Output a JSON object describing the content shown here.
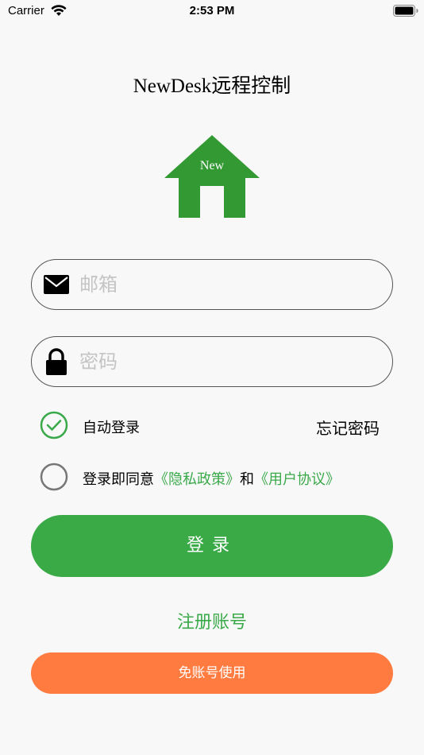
{
  "status_bar": {
    "carrier": "Carrier",
    "time": "2:53 PM",
    "wifi_icon": "wifi-icon",
    "battery_icon": "battery-full-icon"
  },
  "app": {
    "title": "NewDesk远程控制",
    "logo_text": "New",
    "logo_icon": "house-icon",
    "logo_color": "#339933"
  },
  "form": {
    "email": {
      "placeholder": "邮箱",
      "value": "",
      "icon": "mail-icon"
    },
    "password": {
      "placeholder": "密码",
      "value": "",
      "icon": "lock-icon"
    },
    "auto_login": {
      "label": "自动登录",
      "checked": true
    },
    "forgot_password": "忘记密码",
    "agreement": {
      "checked": false,
      "prefix": "登录即同意",
      "privacy_link": "《隐私政策》",
      "conjunction": "和",
      "terms_link": "《用户协议》"
    }
  },
  "actions": {
    "login_label": "登录",
    "register_label": "注册账号",
    "guest_label": "免账号使用"
  },
  "colors": {
    "primary_green": "#3aaa47",
    "guest_orange": "#ff7b3f",
    "link_green": "#3aa94a"
  }
}
